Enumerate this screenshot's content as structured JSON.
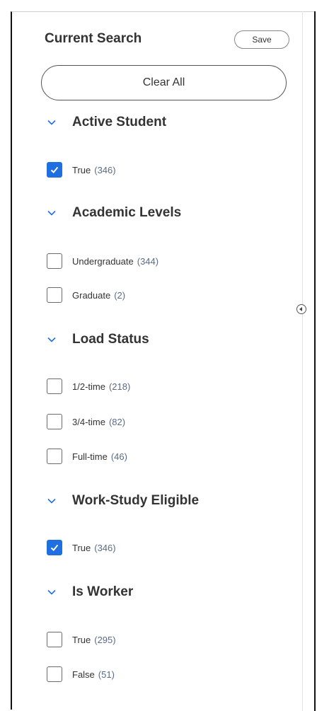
{
  "panel": {
    "title": "Current Search",
    "save_label": "Save",
    "clear_all_label": "Clear All"
  },
  "facets": [
    {
      "title": "Active Student",
      "options": [
        {
          "label": "True",
          "count": "(346)",
          "checked": true
        }
      ]
    },
    {
      "title": "Academic Levels",
      "options": [
        {
          "label": "Undergraduate",
          "count": "(344)",
          "checked": false
        },
        {
          "label": "Graduate",
          "count": "(2)",
          "checked": false
        }
      ]
    },
    {
      "title": "Load Status",
      "options": [
        {
          "label": "1/2-time",
          "count": "(218)",
          "checked": false
        },
        {
          "label": "3/4-time",
          "count": "(82)",
          "checked": false
        },
        {
          "label": "Full-time",
          "count": "(46)",
          "checked": false
        }
      ]
    },
    {
      "title": "Work-Study Eligible",
      "options": [
        {
          "label": "True",
          "count": "(346)",
          "checked": true
        }
      ]
    },
    {
      "title": "Is Worker",
      "options": [
        {
          "label": "True",
          "count": "(295)",
          "checked": false
        },
        {
          "label": "False",
          "count": "(51)",
          "checked": false
        }
      ]
    }
  ],
  "colors": {
    "checkbox_checked": "#1f6fe0",
    "count_text": "#5a6b86",
    "chevron": "#1f6fe0"
  },
  "icons": {
    "section_toggle": "chevron-down-icon",
    "checkbox_mark": "checkmark-icon",
    "panel_toggle": "collapse-left-icon"
  }
}
